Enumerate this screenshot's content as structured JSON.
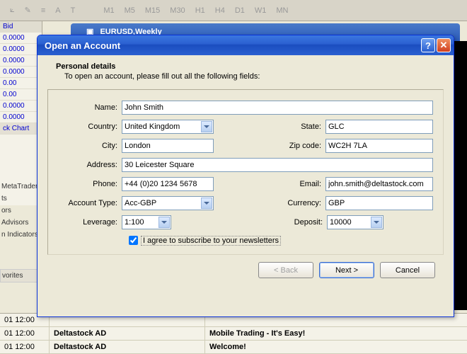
{
  "bg": {
    "toolbar_tf": [
      "M1",
      "M5",
      "M15",
      "M30",
      "H1",
      "H4",
      "D1",
      "W1",
      "MN"
    ],
    "bid_header": "Bid",
    "left_rows": [
      "0.0000",
      "0.0000",
      "0.0000",
      "0.0000",
      "0.00",
      "0.00",
      "0.0000",
      "0.0000"
    ],
    "tab_chart": "ck Chart",
    "nav": [
      "MetaTrader",
      "ts",
      "ors",
      "Advisors",
      "n Indicators"
    ],
    "tab_fav": "vorites",
    "chart_title": "EURUSD,Weekly",
    "grid": [
      {
        "t": "01 12:00",
        "a": "",
        "m": ""
      },
      {
        "t": "01 12:00",
        "a": "Deltastock AD",
        "m": "Mobile Trading - It's Easy!"
      },
      {
        "t": "01 12:00",
        "a": "Deltastock AD",
        "m": "Welcome!"
      }
    ]
  },
  "dialog": {
    "title": "Open an Account",
    "section_title": "Personal details",
    "section_sub": "To open an account, please fill out all the following fields:",
    "labels": {
      "name": "Name:",
      "country": "Country:",
      "state": "State:",
      "city": "City:",
      "zip": "Zip code:",
      "address": "Address:",
      "phone": "Phone:",
      "email": "Email:",
      "account_type": "Account Type:",
      "currency": "Currency:",
      "leverage": "Leverage:",
      "deposit": "Deposit:"
    },
    "values": {
      "name": "John Smith",
      "country": "United Kingdom",
      "state": "GLC",
      "city": "London",
      "zip": "WC2H 7LA",
      "address": "30 Leicester Square",
      "phone": "+44 (0)20 1234 5678",
      "email": "john.smith@deltastock.com",
      "account_type": "Acc-GBP",
      "currency": "GBP",
      "leverage": "1:100",
      "deposit": "10000"
    },
    "newsletter_label": "I agree to subscribe to your newsletters",
    "buttons": {
      "back": "< Back",
      "next": "Next >",
      "cancel": "Cancel"
    }
  }
}
